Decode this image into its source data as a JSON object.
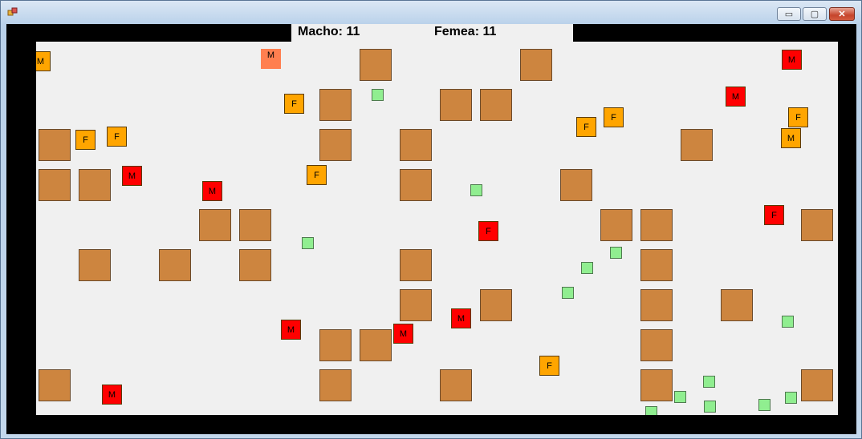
{
  "window": {
    "minimize_glyph": "▭",
    "maximize_glyph": "▢",
    "close_glyph": "✕"
  },
  "header": {
    "male_score": "Macho: 11",
    "female_score": "Femea: 11"
  },
  "colors": {
    "obstacle": "#cd853f",
    "food": "#90ee90",
    "orange_animal": "#ffa500",
    "red_animal": "#ff0000",
    "coral_animal": "#ff7f50"
  },
  "labels": {
    "male": "M",
    "female": "F"
  }
}
